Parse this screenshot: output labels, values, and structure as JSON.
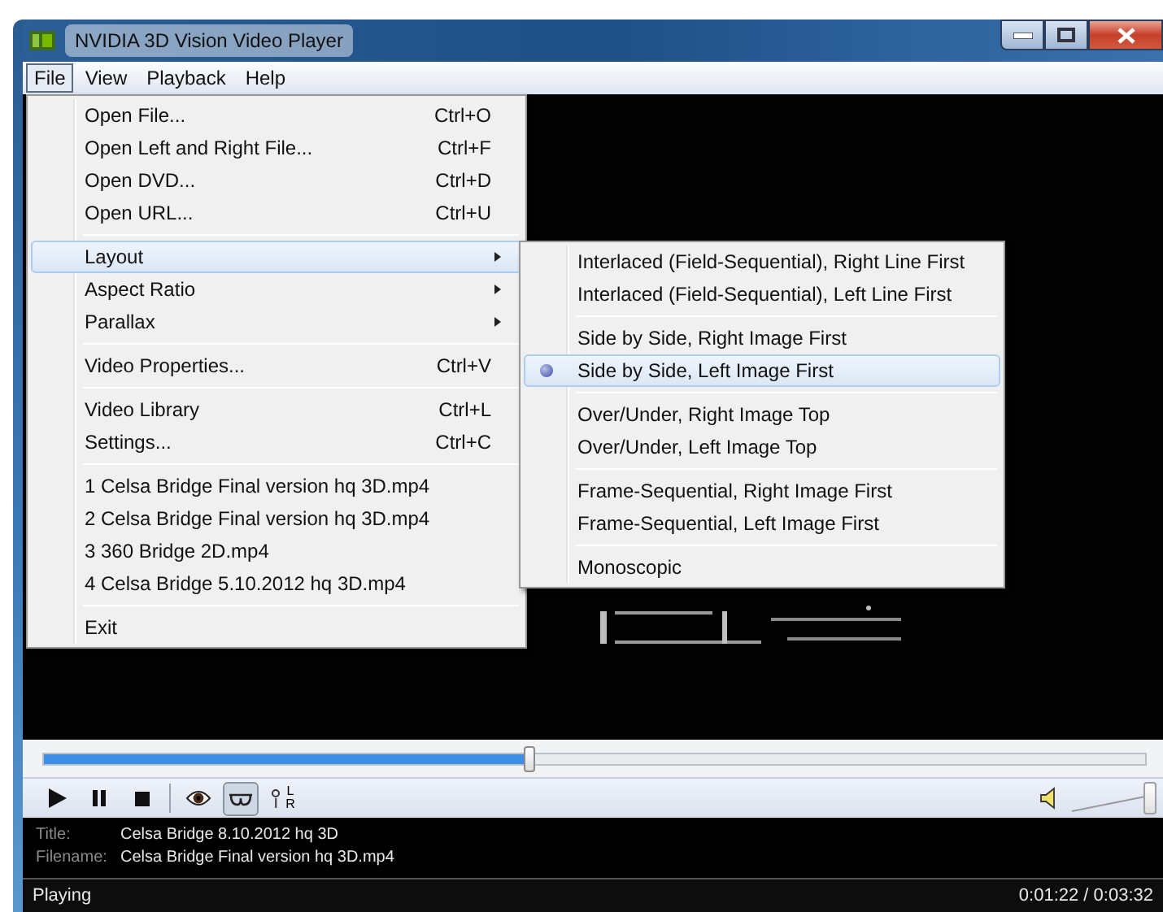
{
  "window": {
    "title": "NVIDIA 3D Vision Video Player"
  },
  "menubar": [
    {
      "label": "File",
      "selected": true
    },
    {
      "label": "View",
      "selected": false
    },
    {
      "label": "Playback",
      "selected": false
    },
    {
      "label": "Help",
      "selected": false
    }
  ],
  "file_menu": [
    {
      "kind": "item",
      "label": "Open File...",
      "shortcut": "Ctrl+O",
      "submenu": false,
      "selected": false
    },
    {
      "kind": "item",
      "label": "Open Left and Right File...",
      "shortcut": "Ctrl+F",
      "submenu": false,
      "selected": false
    },
    {
      "kind": "item",
      "label": "Open DVD...",
      "shortcut": "Ctrl+D",
      "submenu": false,
      "selected": false
    },
    {
      "kind": "item",
      "label": "Open URL...",
      "shortcut": "Ctrl+U",
      "submenu": false,
      "selected": false
    },
    {
      "kind": "separator"
    },
    {
      "kind": "item",
      "label": "Layout",
      "submenu": true,
      "selected": true
    },
    {
      "kind": "item",
      "label": "Aspect Ratio",
      "submenu": true,
      "selected": false
    },
    {
      "kind": "item",
      "label": "Parallax",
      "submenu": true,
      "selected": false
    },
    {
      "kind": "separator"
    },
    {
      "kind": "item",
      "label": "Video Properties...",
      "shortcut": "Ctrl+V",
      "submenu": false,
      "selected": false
    },
    {
      "kind": "separator"
    },
    {
      "kind": "item",
      "label": "Video Library",
      "shortcut": "Ctrl+L",
      "submenu": false,
      "selected": false
    },
    {
      "kind": "item",
      "label": "Settings...",
      "shortcut": "Ctrl+C",
      "submenu": false,
      "selected": false
    },
    {
      "kind": "separator"
    },
    {
      "kind": "item",
      "label": "1 Celsa Bridge Final version hq 3D.mp4",
      "submenu": false,
      "selected": false
    },
    {
      "kind": "item",
      "label": "2 Celsa Bridge Final version hq 3D.mp4",
      "submenu": false,
      "selected": false
    },
    {
      "kind": "item",
      "label": "3 360 Bridge 2D.mp4",
      "submenu": false,
      "selected": false
    },
    {
      "kind": "item",
      "label": "4 Celsa Bridge 5.10.2012 hq 3D.mp4",
      "submenu": false,
      "selected": false
    },
    {
      "kind": "separator"
    },
    {
      "kind": "item",
      "label": "Exit",
      "submenu": false,
      "selected": false
    }
  ],
  "layout_submenu": [
    {
      "kind": "item",
      "label": "Interlaced (Field-Sequential), Right Line First",
      "checked": false,
      "selected": false
    },
    {
      "kind": "item",
      "label": "Interlaced (Field-Sequential), Left Line First",
      "checked": false,
      "selected": false
    },
    {
      "kind": "separator"
    },
    {
      "kind": "item",
      "label": "Side by Side, Right Image First",
      "checked": false,
      "selected": false
    },
    {
      "kind": "item",
      "label": "Side by Side, Left Image First",
      "checked": true,
      "selected": true
    },
    {
      "kind": "separator"
    },
    {
      "kind": "item",
      "label": "Over/Under, Right Image Top",
      "checked": false,
      "selected": false
    },
    {
      "kind": "item",
      "label": "Over/Under, Left Image Top",
      "checked": false,
      "selected": false
    },
    {
      "kind": "separator"
    },
    {
      "kind": "item",
      "label": "Frame-Sequential, Right Image First",
      "checked": false,
      "selected": false
    },
    {
      "kind": "item",
      "label": "Frame-Sequential, Left Image First",
      "checked": false,
      "selected": false
    },
    {
      "kind": "separator"
    },
    {
      "kind": "item",
      "label": "Monoscopic",
      "checked": false,
      "selected": false
    }
  ],
  "seek_bar": {
    "level": 0.44
  },
  "toolbar": [
    {
      "kind": "play"
    },
    {
      "kind": "pause"
    },
    {
      "kind": "stop"
    },
    {
      "kind": "separator"
    },
    {
      "kind": "eye",
      "selected": false
    },
    {
      "kind": "glasses",
      "selected": true
    },
    {
      "kind": "swap",
      "top": "L",
      "bottom": "R",
      "selected": false
    }
  ],
  "volume": {
    "level": 0.95
  },
  "info": [
    {
      "label": "Title:",
      "value": "Celsa Bridge 8.10.2012 hq 3D"
    },
    {
      "label": "Filename:",
      "value": "Celsa Bridge Final version hq 3D.mp4"
    }
  ],
  "status": {
    "state": "Playing",
    "time": "0:01:22 / 0:03:32"
  }
}
